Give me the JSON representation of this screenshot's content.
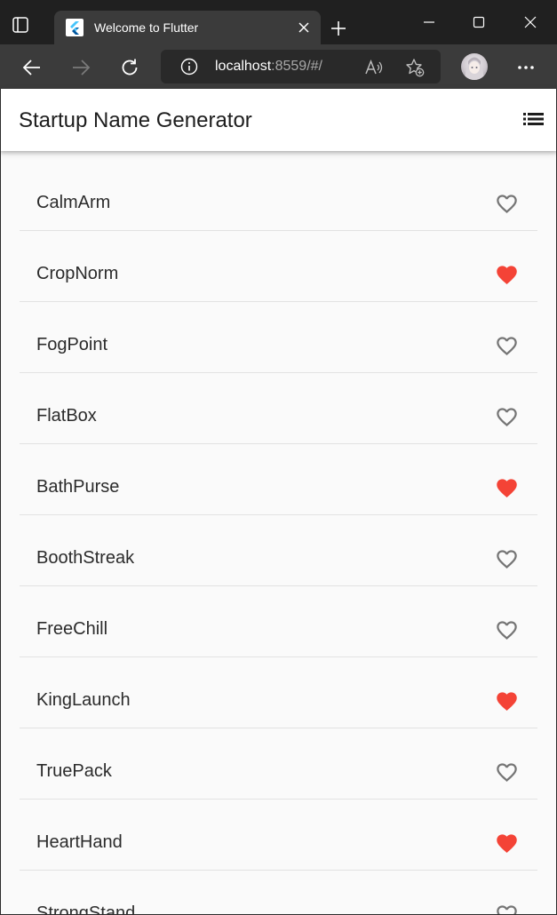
{
  "browser": {
    "tab_title": "Welcome to Flutter",
    "url_host": "localhost",
    "url_rest": ":8559/#/",
    "colors": {
      "titlebar": "#202020",
      "toolbar": "#3b3b3b",
      "address_bg": "#292929"
    }
  },
  "app": {
    "title": "Startup Name Generator",
    "accent_favorite": "#f44336",
    "unfavorite_color": "#757575"
  },
  "items": [
    {
      "name": "CalmArm",
      "saved": false
    },
    {
      "name": "CropNorm",
      "saved": true
    },
    {
      "name": "FogPoint",
      "saved": false
    },
    {
      "name": "FlatBox",
      "saved": false
    },
    {
      "name": "BathPurse",
      "saved": true
    },
    {
      "name": "BoothStreak",
      "saved": false
    },
    {
      "name": "FreeChill",
      "saved": false
    },
    {
      "name": "KingLaunch",
      "saved": true
    },
    {
      "name": "TruePack",
      "saved": false
    },
    {
      "name": "HeartHand",
      "saved": true
    },
    {
      "name": "StrongStand",
      "saved": false
    }
  ]
}
